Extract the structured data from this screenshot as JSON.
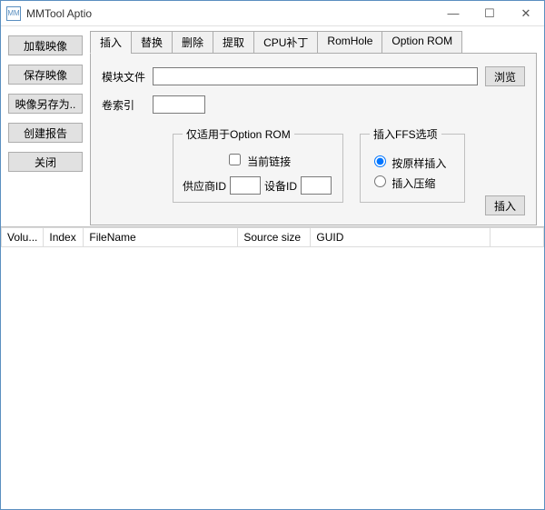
{
  "window": {
    "title": "MMTool Aptio",
    "icon_text": "MM"
  },
  "sidebar": {
    "buttons": [
      {
        "id": "load",
        "label": "加载映像"
      },
      {
        "id": "save",
        "label": "保存映像"
      },
      {
        "id": "saveas",
        "label": "映像另存为.."
      },
      {
        "id": "report",
        "label": "创建报告"
      },
      {
        "id": "close",
        "label": "关闭"
      }
    ]
  },
  "tabs": [
    {
      "id": "insert",
      "label": "插入",
      "active": true
    },
    {
      "id": "replace",
      "label": "替换"
    },
    {
      "id": "delete",
      "label": "删除"
    },
    {
      "id": "extract",
      "label": "提取"
    },
    {
      "id": "cpupatch",
      "label": "CPU补丁"
    },
    {
      "id": "romhole",
      "label": "RomHole"
    },
    {
      "id": "oprom",
      "label": "Option ROM"
    }
  ],
  "panel": {
    "module_file_label": "模块文件",
    "module_file_value": "",
    "browse_label": "浏览",
    "volindex_label": "卷索引",
    "volindex_value": "",
    "group_oprom": {
      "legend": "仅适用于Option ROM",
      "checkbox_label": "当前链接",
      "vendor_label": "供应商ID",
      "vendor_value": "",
      "device_label": "设备ID",
      "device_value": ""
    },
    "group_ffs": {
      "legend": "插入FFS选项",
      "radio_asis": "按原样插入",
      "radio_compress": "插入压缩"
    },
    "insert_button": "插入"
  },
  "table": {
    "columns": [
      "Volu...",
      "Index",
      "FileName",
      "Source size",
      "GUID",
      ""
    ]
  }
}
